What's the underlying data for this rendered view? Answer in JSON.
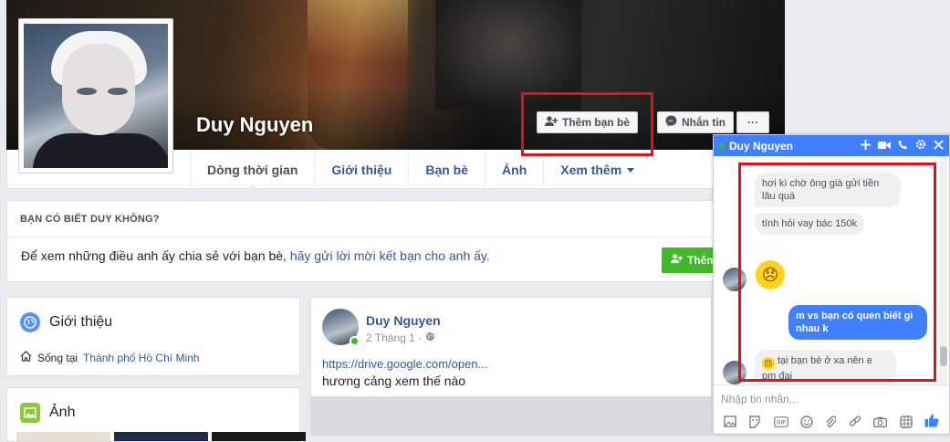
{
  "profile": {
    "name": "Duy Nguyen",
    "add_friend": "Thêm bạn bè",
    "message": "Nhắn tin",
    "more": "···"
  },
  "nav": {
    "tabs": [
      {
        "label": "Dòng thời gian"
      },
      {
        "label": "Giới thiệu"
      },
      {
        "label": "Bạn bè"
      },
      {
        "label": "Ảnh"
      },
      {
        "label": "Xem thêm"
      }
    ]
  },
  "know": {
    "title": "BẠN CÓ BIẾT DUY KHÔNG?",
    "text_plain": "Để xem những điều anh ấy chia sẻ với bạn bè,",
    "text_link": "hãy gửi lời mời kết bạn cho anh ấy.",
    "button": "Thêm"
  },
  "intro": {
    "title": "Giới thiệu",
    "lives_prefix": "Sống tại",
    "lives_city": "Thành phố Hồ Chí Minh"
  },
  "photos": {
    "title": "Ảnh"
  },
  "post": {
    "author": "Duy Nguyen",
    "date": "2 Tháng 1 ·",
    "link": "https://drive.google.com/open...",
    "text": "hương cảng xem thế nào"
  },
  "chat": {
    "name": "Duy Nguyen",
    "messages": [
      {
        "from": "them",
        "text": "hơi kì chờ ông già gửi tiền lâu quá"
      },
      {
        "from": "them",
        "text": "tính hỏi vay bác 150k"
      },
      {
        "from": "me",
        "text": "m vs bạn có quen biết gì nhau k"
      },
      {
        "from": "them",
        "text": "tại bạn bè ở xa nên e pm đại"
      }
    ],
    "emoji": "😞",
    "input_placeholder": "Nhập tin nhắn..."
  },
  "colors": {
    "link": "#365899",
    "messenger_blue": "#4080ff",
    "highlight_red": "#e0121b",
    "green": "#42b72a"
  },
  "icons": [
    "add-friend-icon",
    "messenger-icon",
    "globe-icon",
    "home-icon",
    "photo-icon",
    "gear-icon",
    "close-icon",
    "video-icon",
    "phone-icon",
    "plus-icon",
    "like-icon"
  ]
}
